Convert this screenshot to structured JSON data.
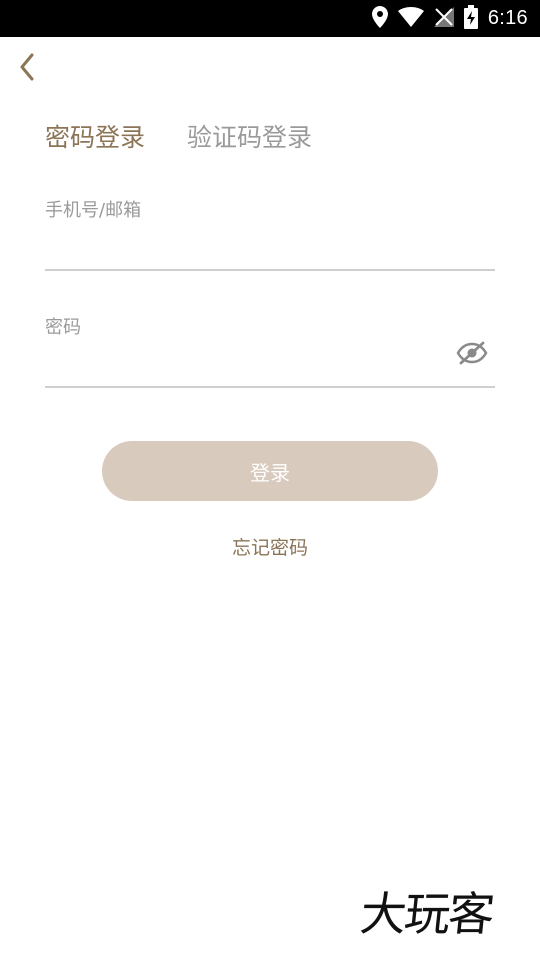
{
  "status_bar": {
    "time": "6:16",
    "icons": [
      "location-icon",
      "wifi-icon",
      "no-signal-icon",
      "battery-charging-icon"
    ]
  },
  "nav": {
    "back_icon": "chevron-left-icon"
  },
  "tabs": [
    {
      "label": "密码登录",
      "active": true
    },
    {
      "label": "验证码登录",
      "active": false
    }
  ],
  "form": {
    "account_label": "手机号/邮箱",
    "account_value": "",
    "password_label": "密码",
    "password_value": "",
    "password_toggle_icon": "eye-hidden-icon"
  },
  "actions": {
    "login_label": "登录",
    "forgot_label": "忘记密码"
  },
  "watermark": "大玩客",
  "colors": {
    "accent": "#8c7456",
    "button_disabled": "#d8cabc",
    "muted_text": "#9a9a9a",
    "divider": "#cfcfcf"
  }
}
